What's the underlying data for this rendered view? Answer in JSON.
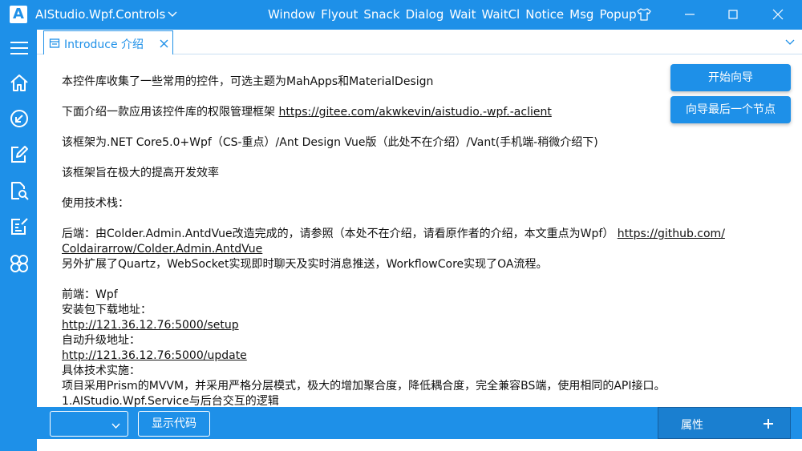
{
  "titlebar": {
    "logo": "A",
    "app_title": "AIStudio.Wpf.Controls",
    "menu": [
      "Window",
      "Flyout",
      "Snack",
      "Dialog",
      "Wait",
      "WaitCl",
      "Notice",
      "Msg",
      "Popup"
    ],
    "icons": [
      "tshirt-icon",
      "minimize-icon",
      "maximize-icon",
      "close-icon"
    ]
  },
  "nav": {
    "icons": [
      "hamburger-menu-icon",
      "home-icon",
      "arrow-down-left-icon",
      "edit-icon",
      "document-search-icon",
      "note-edit-icon",
      "grid-clover-icon"
    ]
  },
  "tab": {
    "label": "Introduce 介绍"
  },
  "content": {
    "line1": "本控件库收集了一些常用的控件，可选主题为MahApps和MaterialDesign",
    "line2_text": "下面介绍一款应用该控件库的权限管理框架 ",
    "line2_link": "https://gitee.com/akwkevin/aistudio.-wpf.-aclient",
    "line3": "该框架为.NET Core5.0+Wpf（CS-重点）/Ant Design Vue版（此处不在介绍）/Vant(手机端-稍微介绍下)",
    "line4": "该框架旨在极大的提高开发效率",
    "line5": "使用技术栈：",
    "line6_text": "后端：由Colder.Admin.AntdVue改造完成的，请参照（本处不在介绍，请看原作者的介绍，本文重点为Wpf）  ",
    "line6_link_a": "https://github.com/",
    "line6_link_b": "Coldairarrow/Colder.Admin.AntdVue",
    "line7": "另外扩展了Quartz，WebSocket实现即时聊天及实时消息推送，WorkflowCore实现了OA流程。",
    "line8": "前端：Wpf",
    "line9": "安装包下载地址：",
    "line10_link": "http://121.36.12.76:5000/setup",
    "line11": "自动升级地址：",
    "line12_link": "http://121.36.12.76:5000/update",
    "line13": "具体技术实施：",
    "line14": "项目采用Prism的MVVM，并采用严格分层模式，极大的增加聚合度，降低耦合度，完全兼容BS端，使用相同的API接口。",
    "line15": "1.AIStudio.Wpf.Service与后台交互的逻辑"
  },
  "actions": {
    "start_guide": "开始向导",
    "guide_last_node": "向导最后一个节点"
  },
  "bottom": {
    "combo_value": "",
    "show_code": "显示代码",
    "properties": "属性"
  },
  "colors": {
    "accent": "#1e90e8",
    "panel_dark": "#1a7fd0"
  }
}
